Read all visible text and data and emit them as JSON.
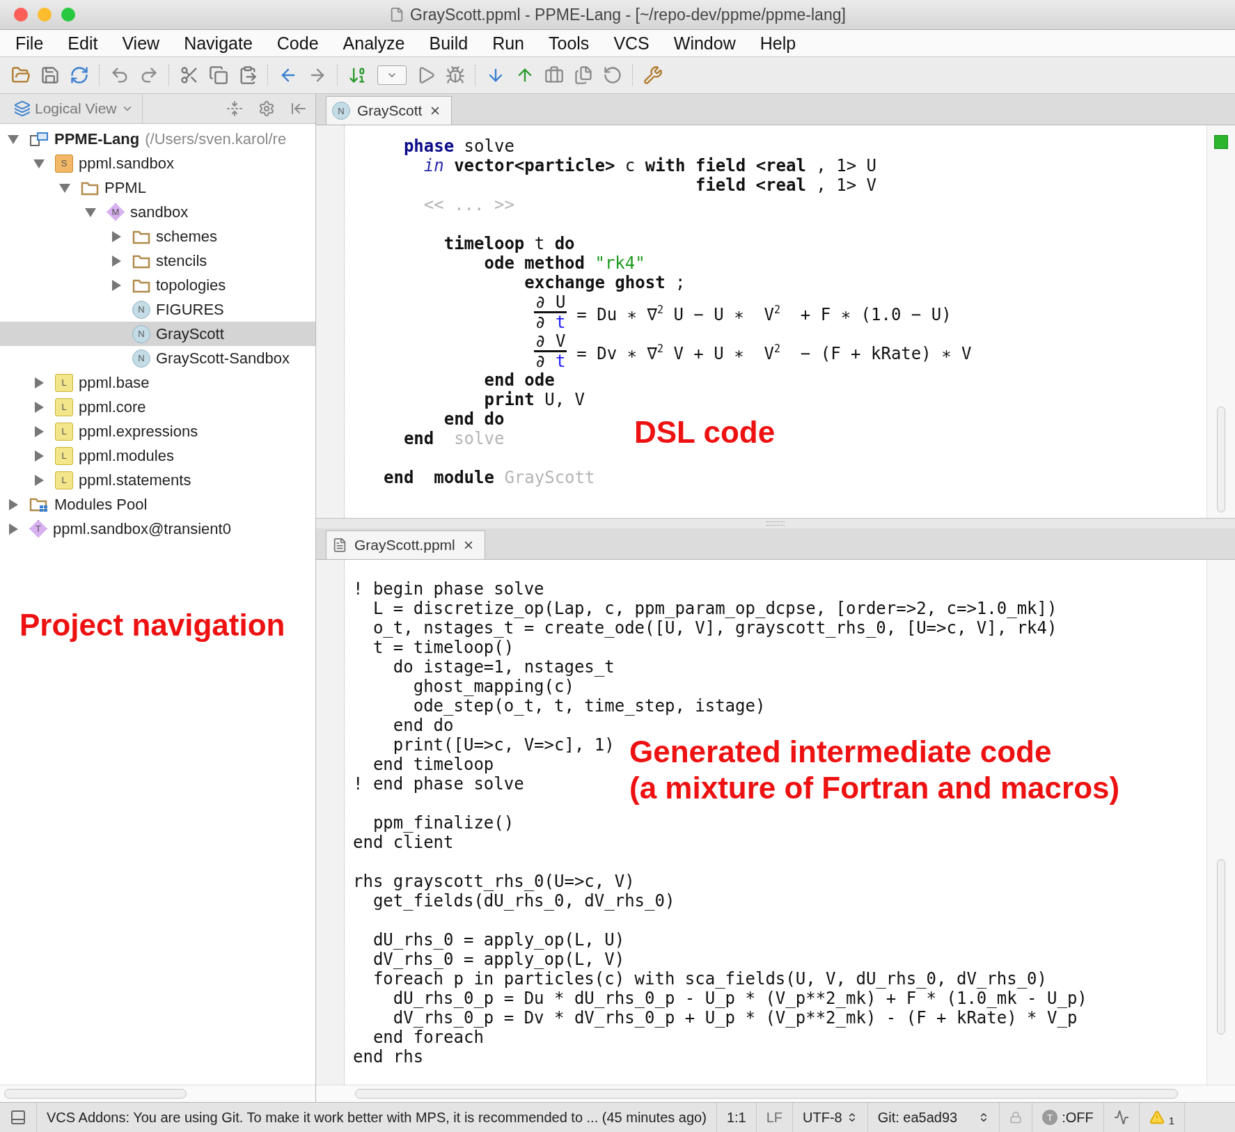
{
  "window": {
    "title": "GrayScott.ppml - PPME-Lang - [~/repo-dev/ppme/ppme-lang]"
  },
  "menu": [
    "File",
    "Edit",
    "View",
    "Navigate",
    "Code",
    "Analyze",
    "Build",
    "Run",
    "Tools",
    "VCS",
    "Window",
    "Help"
  ],
  "sidebar": {
    "view_label": "Logical View",
    "annotation": "Project navigation",
    "tree": [
      {
        "label": "PPME-Lang",
        "suffix": "(/Users/sven.karol/re",
        "kind": "project",
        "expanded": true,
        "selected": false,
        "children": [
          {
            "label": "ppml.sandbox",
            "kind": "solution",
            "icon_letter": "S",
            "expanded": true,
            "selected": false,
            "children": [
              {
                "label": "PPML",
                "kind": "folder",
                "expanded": true,
                "selected": false,
                "children": [
                  {
                    "label": "sandbox",
                    "kind": "model",
                    "icon_letter": "M",
                    "expanded": true,
                    "selected": false,
                    "children": [
                      {
                        "label": "schemes",
                        "kind": "folder",
                        "expanded": false,
                        "selected": false
                      },
                      {
                        "label": "stencils",
                        "kind": "folder",
                        "expanded": false,
                        "selected": false
                      },
                      {
                        "label": "topologies",
                        "kind": "folder",
                        "expanded": false,
                        "selected": false
                      },
                      {
                        "label": "FIGURES",
                        "kind": "node",
                        "icon_letter": "N",
                        "selected": false
                      },
                      {
                        "label": "GrayScott",
                        "kind": "node",
                        "icon_letter": "N",
                        "selected": true
                      },
                      {
                        "label": "GrayScott-Sandbox",
                        "kind": "node",
                        "icon_letter": "N",
                        "selected": false
                      }
                    ]
                  }
                ]
              }
            ]
          },
          {
            "label": "ppml.base",
            "kind": "language",
            "icon_letter": "L",
            "expanded": false,
            "selected": false
          },
          {
            "label": "ppml.core",
            "kind": "language",
            "icon_letter": "L",
            "expanded": false,
            "selected": false
          },
          {
            "label": "ppml.expressions",
            "kind": "language",
            "icon_letter": "L",
            "expanded": false,
            "selected": false
          },
          {
            "label": "ppml.modules",
            "kind": "language",
            "icon_letter": "L",
            "expanded": false,
            "selected": false
          },
          {
            "label": "ppml.statements",
            "kind": "language",
            "icon_letter": "L",
            "expanded": false,
            "selected": false
          }
        ]
      },
      {
        "label": "Modules Pool",
        "kind": "modules",
        "expanded": false,
        "selected": false
      },
      {
        "label": "ppml.sandbox@transient0",
        "kind": "transient",
        "icon_letter": "T",
        "expanded": false,
        "selected": false
      }
    ]
  },
  "dsl_editor": {
    "tab": {
      "label": "GrayScott",
      "icon_letter": "N",
      "selected": true
    },
    "annotation": "DSL code",
    "blocks": [
      [
        {
          "kind": "code",
          "tokens": [
            {
              "kind": "keyword_blue",
              "text": "  phase"
            },
            {
              "kind": "plain",
              "text": " solve"
            }
          ]
        },
        {
          "kind": "code",
          "tokens": [
            {
              "kind": "italic",
              "text": "    in"
            },
            {
              "kind": "keyword",
              "text": " vector<particle>"
            },
            {
              "kind": "plain",
              "text": " c "
            },
            {
              "kind": "keyword",
              "text": "with field <real"
            },
            {
              "kind": "plain",
              "text": " , 1> U"
            }
          ]
        },
        {
          "kind": "code",
          "tokens": [
            {
              "kind": "keyword",
              "text": "                               field <real"
            },
            {
              "kind": "plain",
              "text": " , 1> V"
            }
          ]
        },
        {
          "kind": "code",
          "tokens": [
            {
              "kind": "dim",
              "text": "    << ... >>"
            }
          ]
        }
      ],
      [
        {
          "kind": "code",
          "tokens": [
            {
              "kind": "keyword",
              "text": "      timeloop"
            },
            {
              "kind": "plain",
              "text": " t "
            },
            {
              "kind": "keyword",
              "text": "do"
            }
          ]
        },
        {
          "kind": "code",
          "tokens": [
            {
              "kind": "keyword",
              "text": "          ode method"
            },
            {
              "kind": "string",
              "text": " \"rk4\""
            }
          ]
        },
        {
          "kind": "code",
          "tokens": [
            {
              "kind": "keyword",
              "text": "              exchange ghost"
            },
            {
              "kind": "plain",
              "text": " ;"
            }
          ]
        },
        {
          "kind": "equation",
          "num": [
            {
              "kind": "plain",
              "text": "∂ U"
            }
          ],
          "den": [
            {
              "kind": "plain",
              "text": "∂ "
            },
            {
              "kind": "variable",
              "text": "t"
            }
          ],
          "rhs": [
            {
              "kind": "plain",
              "text": "= Du ∗ ∇"
            },
            {
              "kind": "superscript",
              "text": "2"
            },
            {
              "kind": "plain",
              "text": " U − U ∗  V"
            },
            {
              "kind": "superscript",
              "text": "2"
            },
            {
              "kind": "plain",
              "text": "  + F ∗ (1.0 − U)"
            }
          ]
        },
        {
          "kind": "equation",
          "num": [
            {
              "kind": "plain",
              "text": "∂ V"
            }
          ],
          "den": [
            {
              "kind": "plain",
              "text": "∂ "
            },
            {
              "kind": "variable",
              "text": "t"
            }
          ],
          "rhs": [
            {
              "kind": "plain",
              "text": "= Dv ∗ ∇"
            },
            {
              "kind": "superscript",
              "text": "2"
            },
            {
              "kind": "plain",
              "text": " V + U ∗  V"
            },
            {
              "kind": "superscript",
              "text": "2"
            },
            {
              "kind": "plain",
              "text": "  − (F + kRate) ∗ V"
            }
          ]
        },
        {
          "kind": "code",
          "tokens": [
            {
              "kind": "keyword",
              "text": "          end ode"
            }
          ]
        },
        {
          "kind": "code",
          "tokens": [
            {
              "kind": "keyword",
              "text": "          print"
            },
            {
              "kind": "plain",
              "text": " U, V"
            }
          ]
        },
        {
          "kind": "code",
          "tokens": [
            {
              "kind": "keyword",
              "text": "      end do"
            }
          ]
        },
        {
          "kind": "code",
          "tokens": [
            {
              "kind": "keyword",
              "text": "  end"
            },
            {
              "kind": "dim",
              "text": "  solve"
            }
          ]
        }
      ],
      [
        {
          "kind": "code",
          "tokens": [
            {
              "kind": "keyword",
              "text": "end  module"
            },
            {
              "kind": "dim",
              "text": " GrayScott"
            }
          ]
        }
      ]
    ]
  },
  "generated_editor": {
    "tab": {
      "label": "GrayScott.ppml",
      "selected": true
    },
    "annotation": [
      "Generated intermediate code",
      "(a mixture of Fortran and macros)"
    ],
    "blocks": [
      [
        "! begin phase solve",
        "  L = discretize_op(Lap, c, ppm_param_op_dcpse, [order=>2, c=>1.0_mk])",
        "  o_t, nstages_t = create_ode([U, V], grayscott_rhs_0, [U=>c, V], rk4)",
        "  t = timeloop()",
        "    do istage=1, nstages_t",
        "      ghost_mapping(c)",
        "      ode_step(o_t, t, time_step, istage)",
        "    end do",
        "    print([U=>c, V=>c], 1)",
        "  end timeloop",
        "! end phase solve"
      ],
      [
        "  ppm_finalize()",
        "end client"
      ],
      [
        "rhs grayscott_rhs_0(U=>c, V)",
        "  get_fields(dU_rhs_0, dV_rhs_0)"
      ],
      [
        "  dU_rhs_0 = apply_op(L, U)",
        "  dV_rhs_0 = apply_op(L, V)",
        "  foreach p in particles(c) with sca_fields(U, V, dU_rhs_0, dV_rhs_0)",
        "    dU_rhs_0_p = Du * dU_rhs_0_p - U_p * (V_p**2_mk) + F * (1.0_mk - U_p)",
        "    dV_rhs_0_p = Dv * dV_rhs_0_p + U_p * (V_p**2_mk) - (F + kRate) * V_p",
        "  end foreach",
        "end rhs"
      ]
    ]
  },
  "status_bar": {
    "message": "VCS Addons: You are using Git. To make it work better with MPS, it is recommended to ... (45 minutes ago)",
    "position": "1:1",
    "line_separator": "LF",
    "encoding": "UTF-8",
    "branch": "Git: ea5ad93",
    "mode_badge": "T",
    "mode": ":OFF",
    "warnings": "1"
  }
}
